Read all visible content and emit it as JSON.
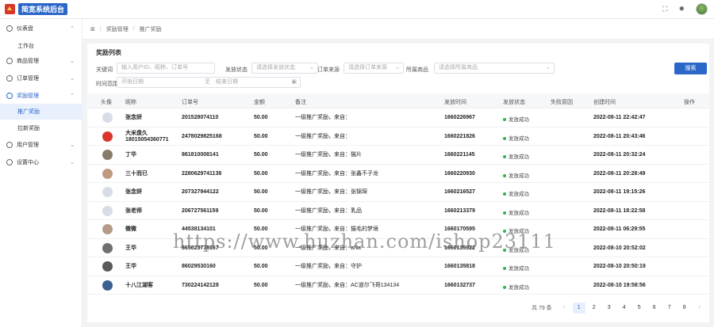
{
  "header": {
    "logo_text": "简宽系统后台",
    "fullscreen_icon": "fullscreen-icon",
    "theme_icon": "sun-icon"
  },
  "sidebar": {
    "items": [
      {
        "label": "仪表盘",
        "icon": "dashboard-icon"
      },
      {
        "label": "工作台"
      },
      {
        "label": "商品管理",
        "icon": "box-icon"
      },
      {
        "label": "订单管理",
        "icon": "list-icon"
      },
      {
        "label": "奖励管理",
        "icon": "gift-icon"
      },
      {
        "label": "推广奖励"
      },
      {
        "label": "拉新奖励"
      },
      {
        "label": "用户管理",
        "icon": "user-icon"
      },
      {
        "label": "设置中心",
        "icon": "gear-icon"
      }
    ]
  },
  "breadcrumb": {
    "home_icon": "grid-icon",
    "items": [
      "奖励管理",
      "推广奖励"
    ]
  },
  "panel": {
    "title": "奖励列表",
    "filters": {
      "keyword_label": "关键词",
      "keyword_placeholder": "输入用户ID、昵称、订单号",
      "status_label": "发放状态",
      "status_placeholder": "请选择发放状态",
      "source_label": "订单来源",
      "source_placeholder": "请选择订单来源",
      "goods_label": "所属商品",
      "goods_placeholder": "请选择所属商品",
      "date_label": "时间范围",
      "date_start": "开始日期",
      "date_sep": "至",
      "date_end": "结束日期",
      "search_button": "搜索"
    },
    "columns": [
      "头像",
      "昵称",
      "订单号",
      "金额",
      "备注",
      "发放时间",
      "发放状态",
      "失败原因",
      "创建时间",
      "操作"
    ],
    "rows": [
      {
        "avatar": "#d7dce6",
        "nickname": "张念妍",
        "order": "201528074110",
        "amount": "50.00",
        "remark": "一级推广奖励，来自：",
        "time": "1660226967",
        "status": "发放成功",
        "created": "2022-08-11 22:42:47"
      },
      {
        "avatar": "#d9362b",
        "nickname": "大米盘久18015054360771",
        "order": "2478029825168",
        "amount": "50.00",
        "remark": "一级推广奖励，来自：",
        "time": "1660221826",
        "status": "发放成功",
        "created": "2022-08-11 20:43:46"
      },
      {
        "avatar": "#8a7a6a",
        "nickname": "丁华",
        "order": "861810008141",
        "amount": "50.00",
        "remark": "一级推广奖励，来自：猫片",
        "time": "1660221145",
        "status": "发放成功",
        "created": "2022-08-11 20:32:24"
      },
      {
        "avatar": "#c09a80",
        "nickname": "三十而已",
        "order": "2280629741138",
        "amount": "50.00",
        "remark": "一级推广奖励，来自：张鑫不子龙",
        "time": "1660220930",
        "status": "发放成功",
        "created": "2022-08-11 20:28:49"
      },
      {
        "avatar": "#d7dce6",
        "nickname": "张念妍",
        "order": "207327944122",
        "amount": "50.00",
        "remark": "一级推广奖励，来自：张锦琛",
        "time": "1660216527",
        "status": "发放成功",
        "created": "2022-08-11 19:15:26"
      },
      {
        "avatar": "#d7dce6",
        "nickname": "张老师",
        "order": "206727561159",
        "amount": "50.00",
        "remark": "一级推广奖励，来自：乳品",
        "time": "1660213379",
        "status": "发放成功",
        "created": "2022-08-11 18:22:58"
      },
      {
        "avatar": "#b59a88",
        "nickname": "微微",
        "order": "44538134101",
        "amount": "50.00",
        "remark": "一级推广奖励，来自：猫毛的梦境",
        "time": "1660170595",
        "status": "发放成功",
        "created": "2022-08-11 06:29:55"
      },
      {
        "avatar": "#707070",
        "nickname": "王华",
        "order": "865023778167",
        "amount": "50.00",
        "remark": "一级推广奖励，来自：aNa",
        "time": "1660135922",
        "status": "发放成功",
        "created": "2022-08-10 20:52:02"
      },
      {
        "avatar": "#5a5a5a",
        "nickname": "王华",
        "order": "86029530160",
        "amount": "50.00",
        "remark": "一级推广奖励，来自：守护",
        "time": "1660135818",
        "status": "发放成功",
        "created": "2022-08-10 20:50:19"
      },
      {
        "avatar": "#3b5f8f",
        "nickname": "十八江湖客",
        "order": "730224142128",
        "amount": "50.00",
        "remark": "一级推广奖励，来自：AC道尔飞哥134134",
        "time": "1660132737",
        "status": "发放成功",
        "created": "2022-08-10 19:58:56"
      }
    ],
    "pagination": {
      "total": "共 79 条",
      "prev": "‹",
      "pages": [
        "1",
        "2",
        "3",
        "4",
        "5",
        "6",
        "7",
        "8"
      ],
      "next": "›",
      "current": "1"
    }
  },
  "watermark": "https://www.huzhan.com/ishop23111"
}
